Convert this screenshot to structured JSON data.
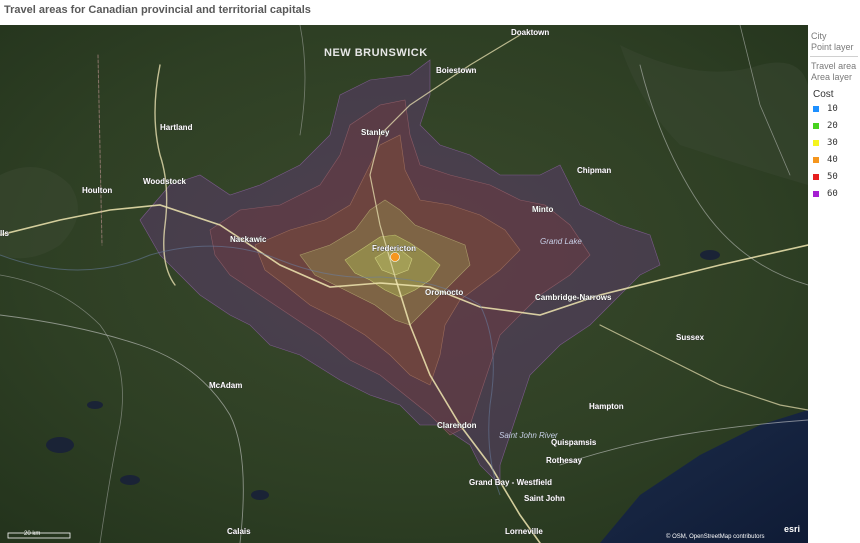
{
  "title": "Travel areas for Canadian provincial and territorial capitals",
  "legend": {
    "layers": [
      {
        "name": "City",
        "type": "Point layer"
      },
      {
        "name": "Travel area",
        "type": "Area layer"
      }
    ],
    "heading": "Cost",
    "items": [
      {
        "value": "10",
        "color": "#1e90ff"
      },
      {
        "value": "20",
        "color": "#47d21e"
      },
      {
        "value": "30",
        "color": "#f5f51e"
      },
      {
        "value": "40",
        "color": "#f5961e"
      },
      {
        "value": "50",
        "color": "#e61e1e"
      },
      {
        "value": "60",
        "color": "#a51ed2"
      }
    ]
  },
  "map": {
    "province_label": "NEW BRUNSWICK",
    "places": [
      "Doaktown",
      "Boiestown",
      "Hartland",
      "Stanley",
      "Chipman",
      "Houlton",
      "Woodstock",
      "Minto",
      "Nackawic",
      "Fredericton",
      "Grand Lake",
      "Oromocto",
      "Cambridge-Narrows",
      "Sussex",
      "McAdam",
      "Hampton",
      "Clarendon",
      "Saint John River",
      "Quispamsis",
      "Rothesay",
      "Grand Bay - Westfield",
      "Saint John",
      "Calais",
      "Lorneville",
      "lls"
    ],
    "scale_label": "20 km",
    "attribution": "© OSM, OpenStreetMap contributors",
    "logo": "esri",
    "city_color": "#f5961e"
  }
}
